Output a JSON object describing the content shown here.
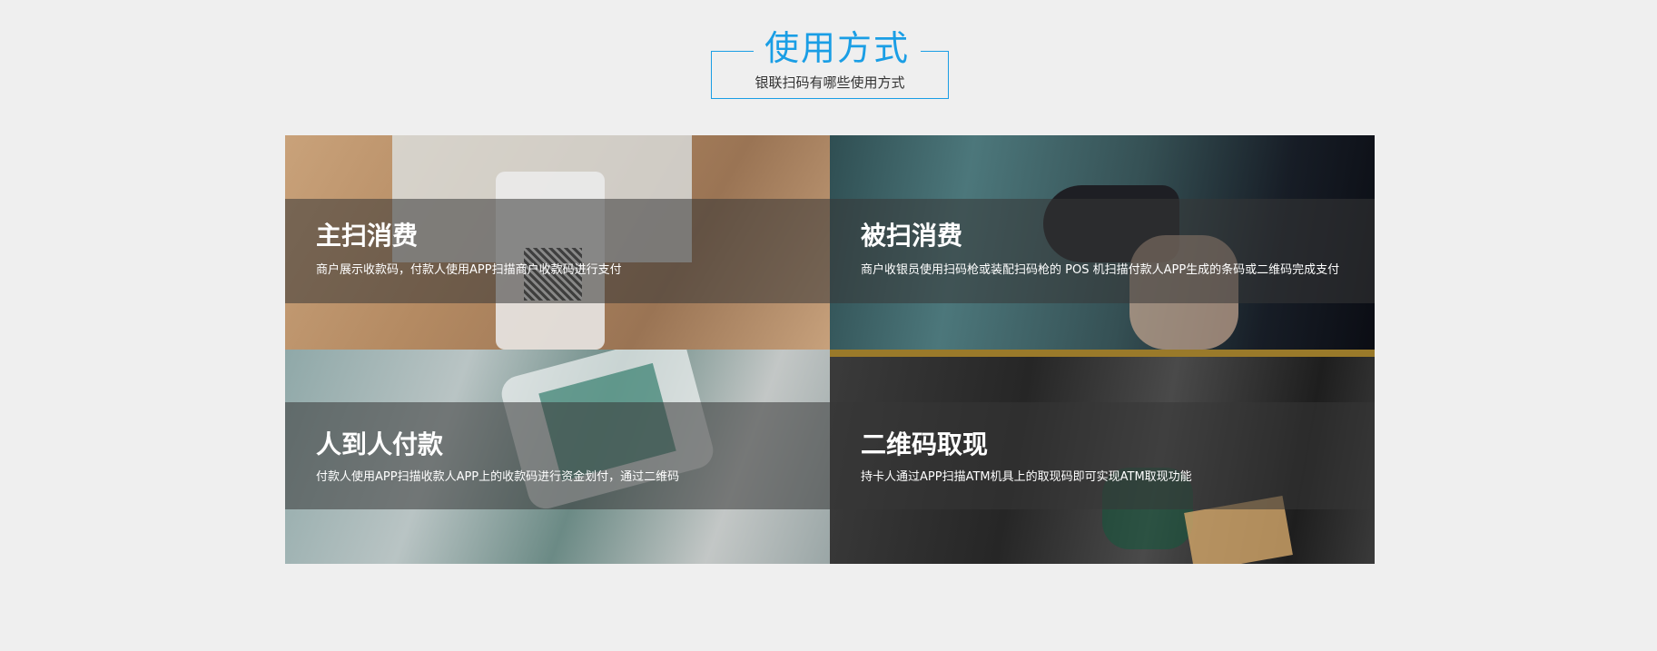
{
  "header": {
    "title": "使用方式",
    "subtitle": "银联扫码有哪些使用方式"
  },
  "cards": [
    {
      "title": "主扫消费",
      "desc": "商户展示收款码，付款人使用APP扫描商户收款码进行支付"
    },
    {
      "title": "被扫消费",
      "desc": "商户收银员使用扫码枪或装配扫码枪的 POS 机扫描付款人APP生成的条码或二维码完成支付"
    },
    {
      "title": "人到人付款",
      "desc": "付款人使用APP扫描收款人APP上的收款码进行资金划付，通过二维码"
    },
    {
      "title": "二维码取现",
      "desc": "持卡人通过APP扫描ATM机具上的取现码即可实现ATM取现功能"
    }
  ],
  "colors": {
    "accent": "#1a9ee5",
    "background": "#efefef",
    "overlay": "rgba(55,55,55,0.55)"
  }
}
